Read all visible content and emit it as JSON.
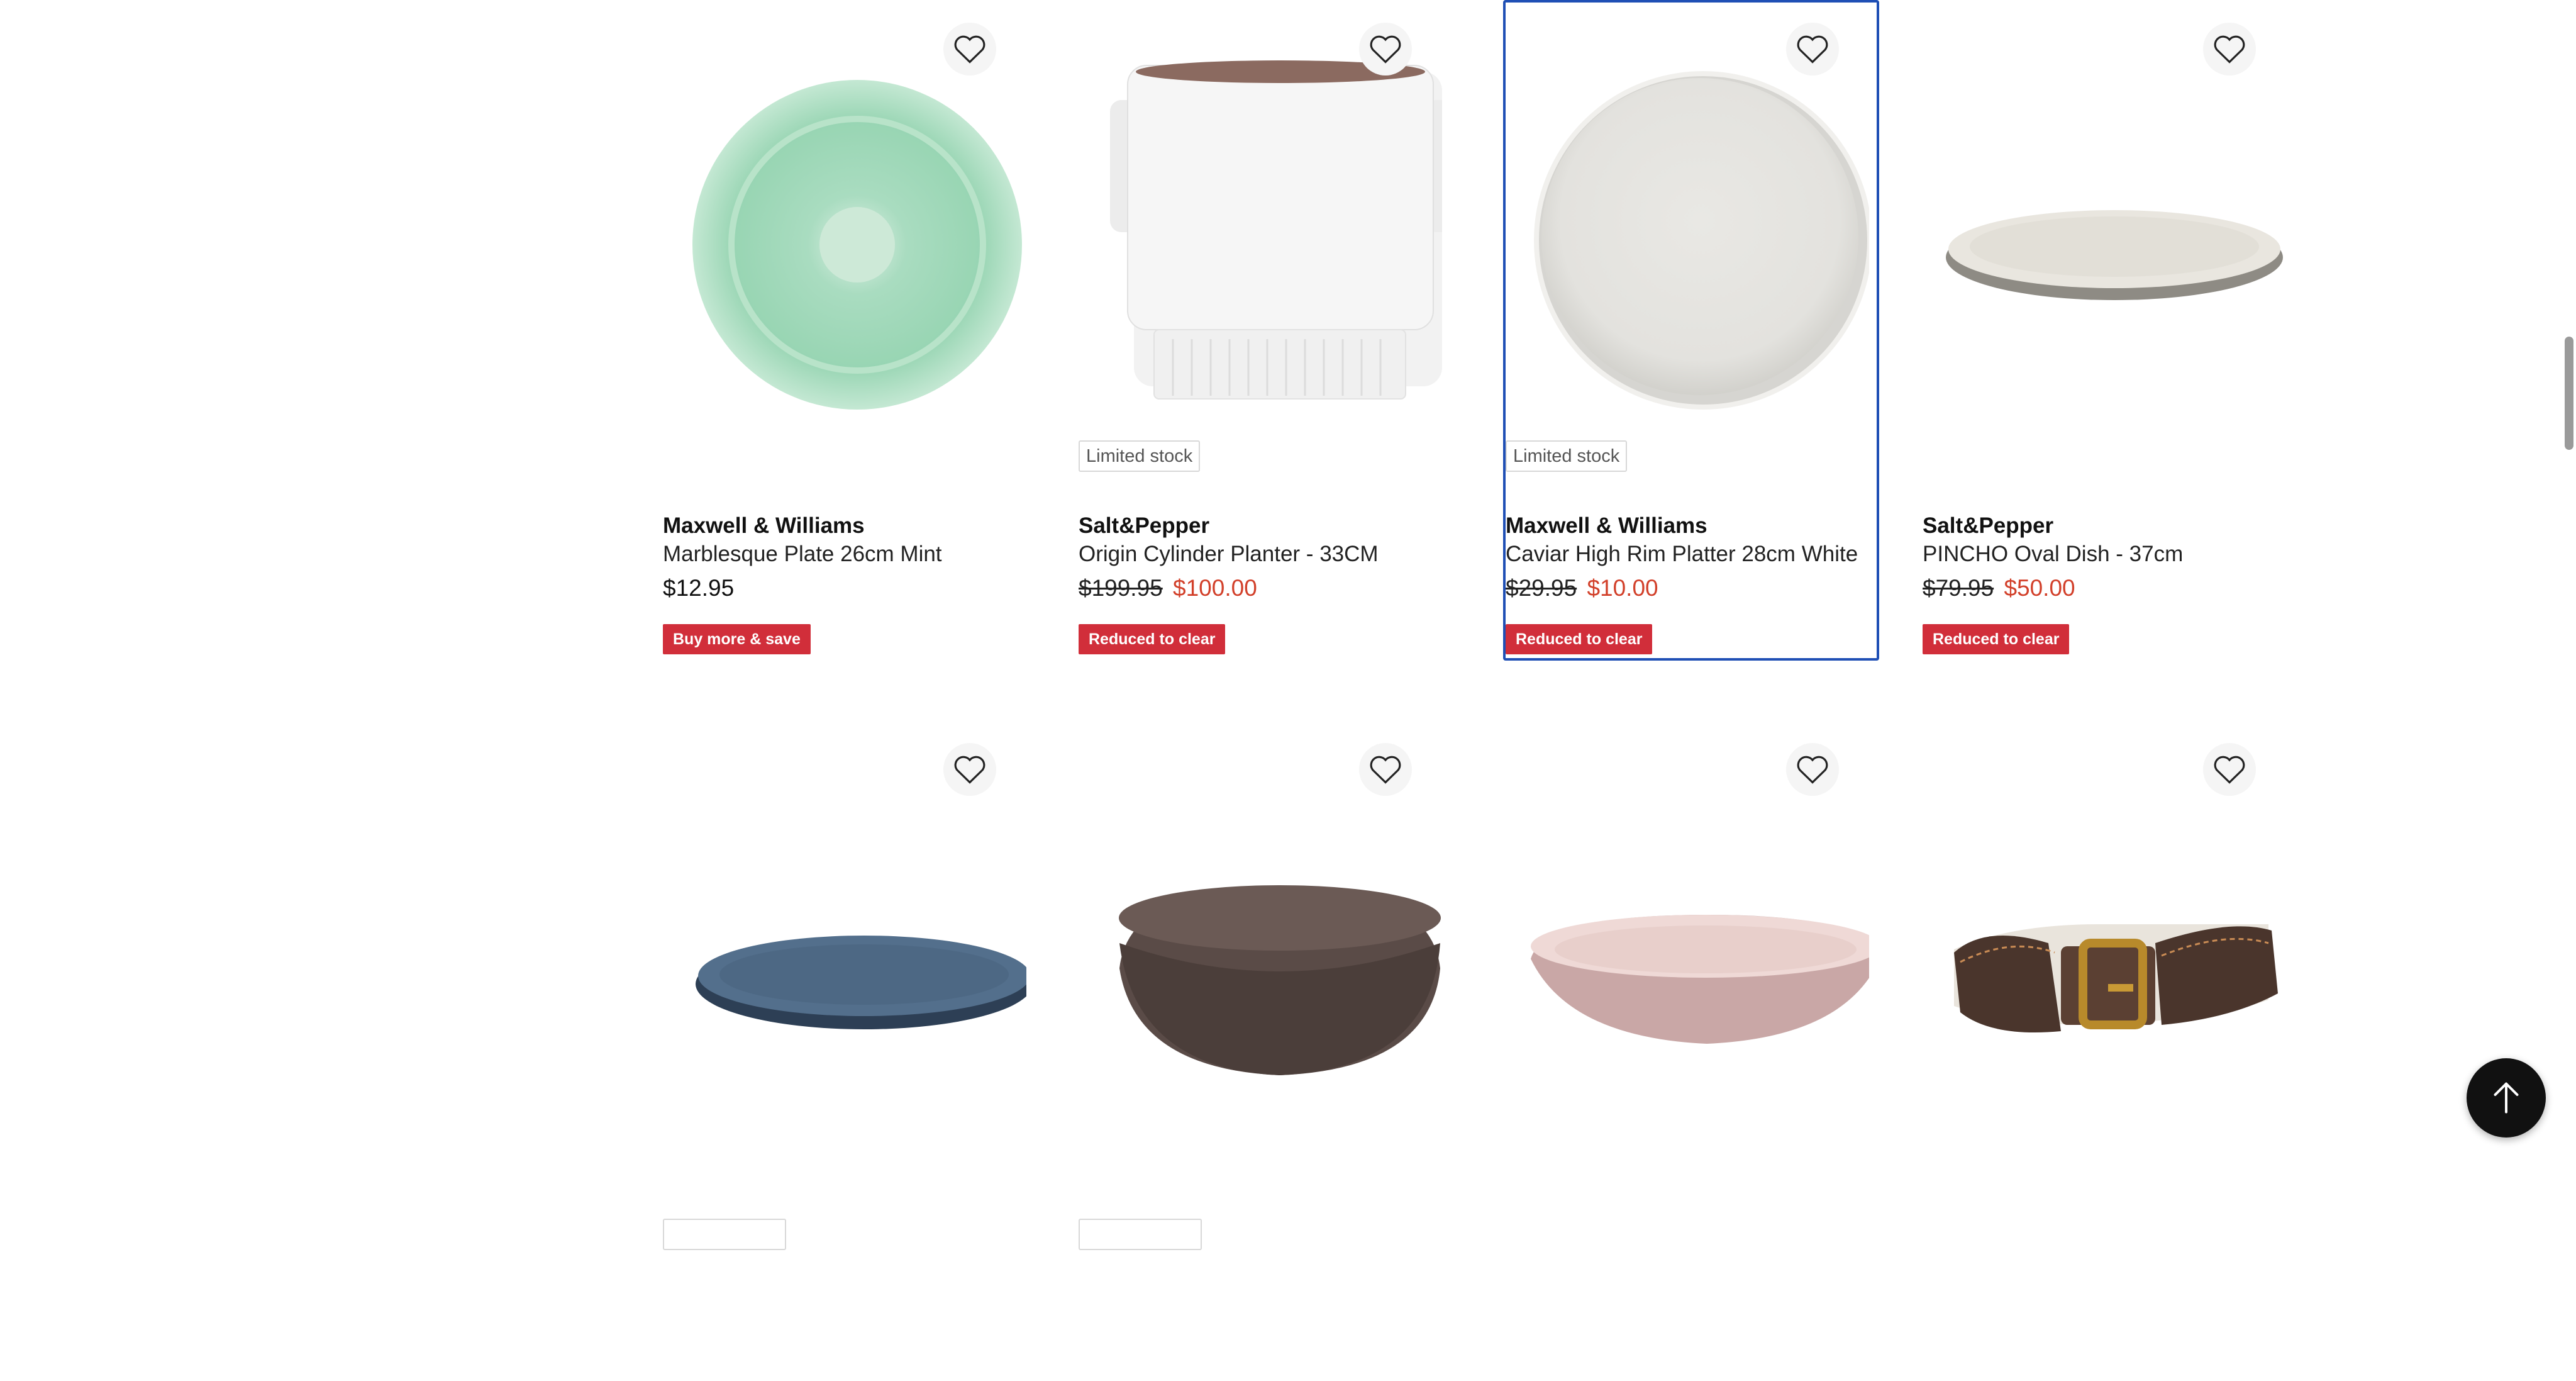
{
  "colors": {
    "accent_focus": "#1f4fb5",
    "sale_price": "#d2402a",
    "promo_badge": "#d12e3a"
  },
  "icons": {
    "wishlist": "heart-outline-icon",
    "back_to_top": "arrow-up-icon"
  },
  "products": [
    {
      "brand": "Maxwell & Williams",
      "name": "Marblesque Plate 26cm Mint",
      "price": "$12.95",
      "promo": "Buy more & save",
      "image": "mint-plate"
    },
    {
      "stock": "Limited stock",
      "brand": "Salt&Pepper",
      "name": "Origin Cylinder Planter - 33CM",
      "was_price": "$199.95",
      "now_price": "$100.00",
      "promo": "Reduced to clear",
      "image": "white-planter"
    },
    {
      "stock": "Limited stock",
      "brand": "Maxwell & Williams",
      "name": "Caviar High Rim Platter 28cm White",
      "was_price": "$29.95",
      "now_price": "$10.00",
      "promo": "Reduced to clear",
      "selected": true,
      "image": "white-platter"
    },
    {
      "brand": "Salt&Pepper",
      "name": "PINCHO Oval Dish - 37cm",
      "was_price": "$79.95",
      "now_price": "$50.00",
      "promo": "Reduced to clear",
      "image": "oval-dish-cream"
    },
    {
      "image": "blue-oval-dish"
    },
    {
      "image": "brown-bowl"
    },
    {
      "image": "pink-bowl"
    },
    {
      "image": "leather-dog-collar"
    }
  ]
}
